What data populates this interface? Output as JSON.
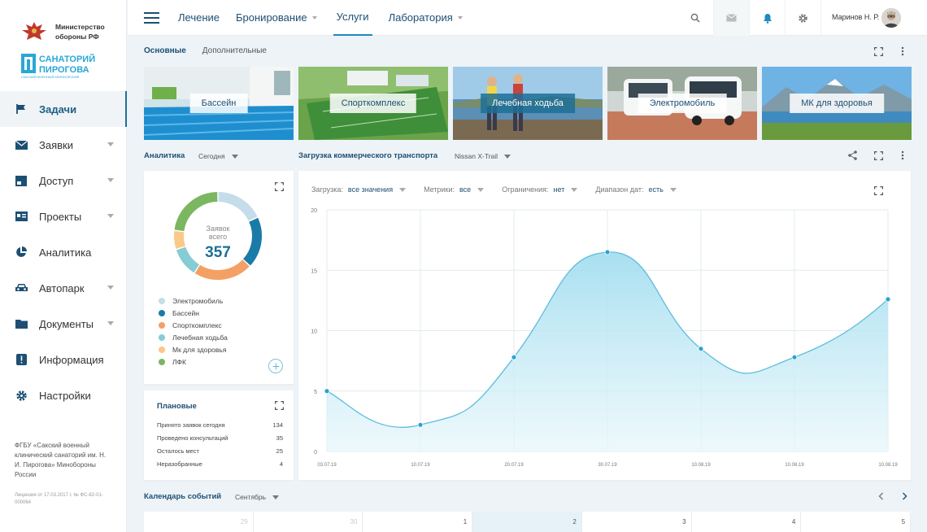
{
  "org_logo": {
    "title_line1": "Министерство",
    "title_line2": "обороны РФ"
  },
  "brand": {
    "line1": "САНАТОРИЙ",
    "line2": "ПИРОГОВА",
    "line3": "САКСКИЙ ВОЕННЫЙ КЛИНИЧЕСКИЙ"
  },
  "sidebar": {
    "items": [
      {
        "label": "Задачи",
        "icon": "flag-icon",
        "active": true,
        "dropdown": false
      },
      {
        "label": "Заявки",
        "icon": "envelope-icon",
        "dropdown": true
      },
      {
        "label": "Доступ",
        "icon": "window-icon",
        "dropdown": true
      },
      {
        "label": "Проекты",
        "icon": "id-card-icon",
        "dropdown": true
      },
      {
        "label": "Аналитика",
        "icon": "pie-chart-icon",
        "dropdown": false
      },
      {
        "label": "Автопарк",
        "icon": "car-icon",
        "dropdown": true
      },
      {
        "label": "Документы",
        "icon": "folder-icon",
        "dropdown": true
      },
      {
        "label": "Информация",
        "icon": "info-icon",
        "dropdown": false
      },
      {
        "label": "Настройки",
        "icon": "gear-icon",
        "dropdown": false
      }
    ],
    "org_text": "ФГБУ «Сакский военный клинический санаторий им. Н. И. Пирогова» Минобороны России",
    "license": "Лицензия от 17.03.2017 г. № ФС-82-01-000064"
  },
  "topbar": {
    "menu": [
      {
        "label": "Лечение",
        "dropdown": false
      },
      {
        "label": "Бронирование",
        "dropdown": true
      },
      {
        "label": "Услуги",
        "dropdown": false,
        "active": true
      },
      {
        "label": "Лаборатория",
        "dropdown": true
      }
    ],
    "user_name": "Маринов Н. Р."
  },
  "tabs": [
    {
      "label": "Основные",
      "active": true
    },
    {
      "label": "Дополнительные"
    }
  ],
  "service_cards": [
    {
      "label": "Бассейн",
      "style": "light"
    },
    {
      "label": "Спорткомплекс",
      "style": "light"
    },
    {
      "label": "Лечебная ходьба",
      "style": "dark"
    },
    {
      "label": "Электромобиль",
      "style": "light"
    },
    {
      "label": "МК для здоровья",
      "style": "light"
    }
  ],
  "analytics": {
    "title": "Аналитика",
    "period": "Сегодня",
    "donut_label_line1": "Заявок",
    "donut_label_line2": "всего",
    "total": "357",
    "legend": [
      {
        "label": "Электромобиль",
        "color": "#c5dceb"
      },
      {
        "label": "Бассейн",
        "color": "#1a7ba8"
      },
      {
        "label": "Спорткомплекс",
        "color": "#f4a064"
      },
      {
        "label": "Лечебная ходьба",
        "color": "#86ccd4"
      },
      {
        "label": "Мк для здоровья",
        "color": "#fbc888"
      },
      {
        "label": "ЛФК",
        "color": "#7bb661"
      }
    ],
    "donut_values": [
      18,
      19,
      22,
      11,
      7,
      23
    ]
  },
  "planned": {
    "title": "Плановые",
    "rows": [
      {
        "label": "Принято заявок сегодня",
        "value": "134"
      },
      {
        "label": "Проведено консультаций",
        "value": "35"
      },
      {
        "label": "Осталось мест",
        "value": "25"
      },
      {
        "label": "Неразобранные",
        "value": "4"
      }
    ]
  },
  "transport": {
    "title": "Загрузка коммерческого транспорта",
    "vehicle": "Nissan X-Trail",
    "filters": [
      {
        "key": "Загрузка:",
        "value": "все значения"
      },
      {
        "key": "Метрики:",
        "value": "все"
      },
      {
        "key": "Ограничения:",
        "value": "нет"
      },
      {
        "key": "Диапазон дат:",
        "value": "есть"
      }
    ]
  },
  "chart_data": {
    "type": "area",
    "x": [
      "03.07.19",
      "10.07.19",
      "20.07.19",
      "30.07.19",
      "10.08.19",
      "10.08.19",
      "10.08.19"
    ],
    "values": [
      5,
      2.2,
      7.8,
      16.5,
      8.5,
      7.8,
      12.6
    ],
    "ylim": [
      0,
      20
    ],
    "yticks": [
      0,
      5,
      10,
      15,
      20
    ],
    "grid": true,
    "color": "#29a3d1"
  },
  "calendar": {
    "title": "Календарь событий",
    "month": "Сентябрь",
    "days": [
      {
        "label": "29",
        "muted": true
      },
      {
        "label": "30",
        "muted": true
      },
      {
        "label": "1"
      },
      {
        "label": "2",
        "highlight": true
      },
      {
        "label": "3"
      },
      {
        "label": "4"
      },
      {
        "label": "5"
      }
    ]
  }
}
